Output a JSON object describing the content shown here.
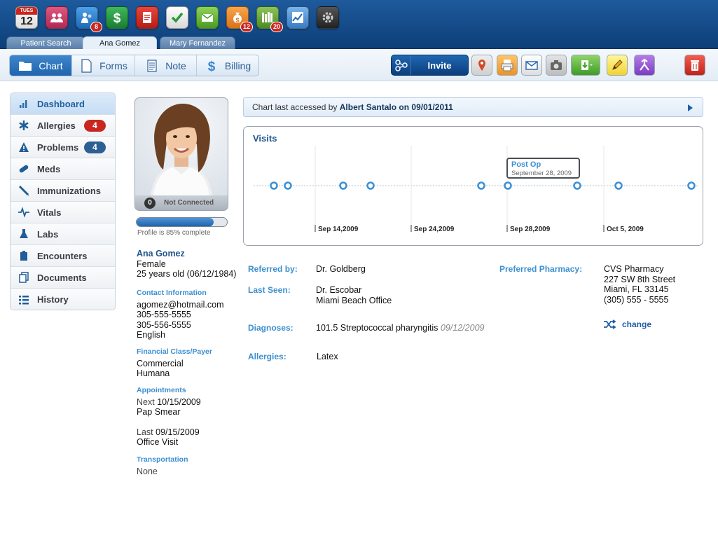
{
  "colors": {
    "brand_blue": "#0d3f78",
    "accent_blue": "#3c8fd0",
    "badge_red": "#c8261f",
    "badge_blue": "#2d5f94"
  },
  "app_bar": {
    "calendar": {
      "day": "TUES",
      "date": "12"
    },
    "apps": [
      {
        "icon": "users-group-icon"
      },
      {
        "icon": "patients-icon",
        "badge": "8"
      },
      {
        "icon": "dollar-icon"
      },
      {
        "icon": "document-icon"
      },
      {
        "icon": "checkmark-icon"
      },
      {
        "icon": "inbox-icon"
      },
      {
        "icon": "money-bag-icon",
        "badge": "12"
      },
      {
        "icon": "library-icon",
        "badge": "20"
      },
      {
        "icon": "line-chart-icon"
      },
      {
        "icon": "gear-icon"
      }
    ]
  },
  "tabs": [
    {
      "label": "Patient Search"
    },
    {
      "label": "Ana Gomez",
      "active": true
    },
    {
      "label": "Mary Fernandez"
    }
  ],
  "toolbar": {
    "segments": [
      {
        "label": "Chart",
        "icon": "folder-icon",
        "active": true
      },
      {
        "label": "Forms",
        "icon": "page-icon"
      },
      {
        "label": "Note",
        "icon": "notepad-icon"
      },
      {
        "label": "Billing",
        "icon": "dollar-sign-icon"
      }
    ],
    "invite_label": "Invite",
    "tools": [
      "map-pin-icon",
      "printer-icon",
      "envelope-icon",
      "camera-icon",
      "export-icon",
      "pencil-icon",
      "merge-icon",
      "trash-icon"
    ]
  },
  "sidebar": {
    "items": [
      {
        "label": "Dashboard",
        "icon": "bar-chart-icon",
        "active": true
      },
      {
        "label": "Allergies",
        "icon": "asterisk-icon",
        "badge": "4",
        "badge_color": "#c8261f"
      },
      {
        "label": "Problems",
        "icon": "warning-icon",
        "badge": "4",
        "badge_color": "#2d5f94"
      },
      {
        "label": "Meds",
        "icon": "pill-icon"
      },
      {
        "label": "Immunizations",
        "icon": "syringe-icon"
      },
      {
        "label": "Vitals",
        "icon": "heartbeat-icon"
      },
      {
        "label": "Labs",
        "icon": "flask-icon"
      },
      {
        "label": "Encounters",
        "icon": "clipboard-icon"
      },
      {
        "label": "Documents",
        "icon": "documents-icon"
      },
      {
        "label": "History",
        "icon": "list-icon"
      }
    ]
  },
  "patient": {
    "connection_count": "0",
    "connection_status": "Not Connected",
    "profile_complete": 0.85,
    "profile_text": "Profile is 85% complete",
    "name": "Ana Gomez",
    "gender": "Female",
    "age": "25 years old (06/12/1984)",
    "contact_heading": "Contact Information",
    "email": "agomez@hotmail.com",
    "phone1": "305-555-5555",
    "phone2": "305-556-5555",
    "language": "English",
    "financial_heading": "Financial Class/Payer",
    "financial_class": "Commercial",
    "payer": "Humana",
    "appointments_heading": "Appointments",
    "next_label": "Next",
    "next_date": "10/15/2009",
    "next_type": "Pap Smear",
    "last_label": "Last",
    "last_date": "09/15/2009",
    "last_type": "Office Visit",
    "transportation_heading": "Transportation",
    "transportation": "None"
  },
  "banner": {
    "prefix": "Chart last accessed by",
    "who_when": "Albert Santalo on 09/01/2011"
  },
  "visits": {
    "title": "Visits",
    "tooltip_title": "Post Op",
    "tooltip_date": "September 28, 2009",
    "axis_labels": [
      "Sep 14,2009",
      "Sep 24,2009",
      "Sep 28,2009",
      "Oct 5, 2009"
    ]
  },
  "details": {
    "referred_label": "Referred by:",
    "referred_value": "Dr. Goldberg",
    "last_seen_label": "Last Seen:",
    "last_seen_doctor": "Dr. Escobar",
    "last_seen_office": "Miami Beach Office",
    "pharmacy_label": "Preferred Pharmacy:",
    "pharmacy_name": "CVS Pharmacy",
    "pharmacy_street": "227 SW 8th Street",
    "pharmacy_city": "Miami, FL 33145",
    "pharmacy_phone": "(305) 555 - 5555",
    "diagnoses_label": "Diagnoses:",
    "diagnosis": "101.5  Streptococcal pharyngitis",
    "diagnosis_date": "09/12/2009",
    "change_label": "change",
    "allergies_label": "Allergies:",
    "allergies_value": "Latex"
  }
}
